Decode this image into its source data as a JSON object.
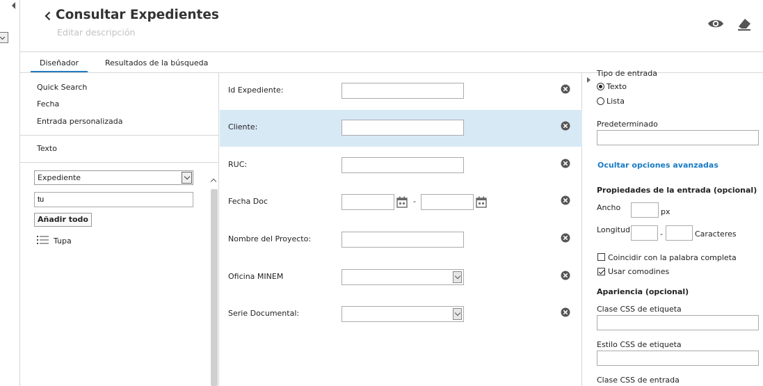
{
  "header": {
    "title": "Consultar Expedientes",
    "description_placeholder": "Editar descripción"
  },
  "tabs": [
    {
      "label": "Diseñador",
      "active": true
    },
    {
      "label": "Resultados de la búsqueda",
      "active": false
    }
  ],
  "left_panel": {
    "items": [
      "Quick Search",
      "Fecha",
      "Entrada personalizada"
    ],
    "text_item": "Texto",
    "select_value": "Expediente",
    "search_value": "tu",
    "add_all_label": "Añadir todo",
    "results": [
      {
        "icon": "list-icon",
        "label": "Tupa"
      }
    ]
  },
  "fields": [
    {
      "label": "Id Expediente:",
      "type": "text",
      "selected": false
    },
    {
      "label": "Cliente:",
      "type": "text",
      "selected": true
    },
    {
      "label": "RUC:",
      "type": "text",
      "selected": false
    },
    {
      "label": "Fecha Doc",
      "type": "date-range",
      "selected": false,
      "separator": "-"
    },
    {
      "label": "Nombre del Proyecto:",
      "type": "text",
      "selected": false
    },
    {
      "label": "Oficina MINEM",
      "type": "select",
      "selected": false
    },
    {
      "label": "Serie Documental:",
      "type": "select",
      "selected": false
    }
  ],
  "right_panel": {
    "input_type_title": "Tipo de entrada",
    "input_type_options": [
      {
        "label": "Texto",
        "checked": true
      },
      {
        "label": "Lista",
        "checked": false
      }
    ],
    "default_label": "Predeterminado",
    "advanced_link": "Ocultar opciones avanzadas",
    "props_title": "Propiedades de la entrada (opcional)",
    "width_label": "Ancho",
    "width_unit": "px",
    "length_label": "Longitud",
    "length_separator": "-",
    "length_unit": "Caracteres",
    "checkboxes": [
      {
        "label": "Coincidir con la palabra completa",
        "checked": false
      },
      {
        "label": "Usar comodines",
        "checked": true
      }
    ],
    "appearance_title": "Apariencia (opcional)",
    "label_css_class": "Clase CSS de etiqueta",
    "label_css_style": "Estilo CSS de etiqueta",
    "input_css_class": "Clase CSS de entrada"
  },
  "colors": {
    "accent": "#1f7ac2",
    "selected_row": "#d8e9f6",
    "link": "#1a7bc4"
  }
}
